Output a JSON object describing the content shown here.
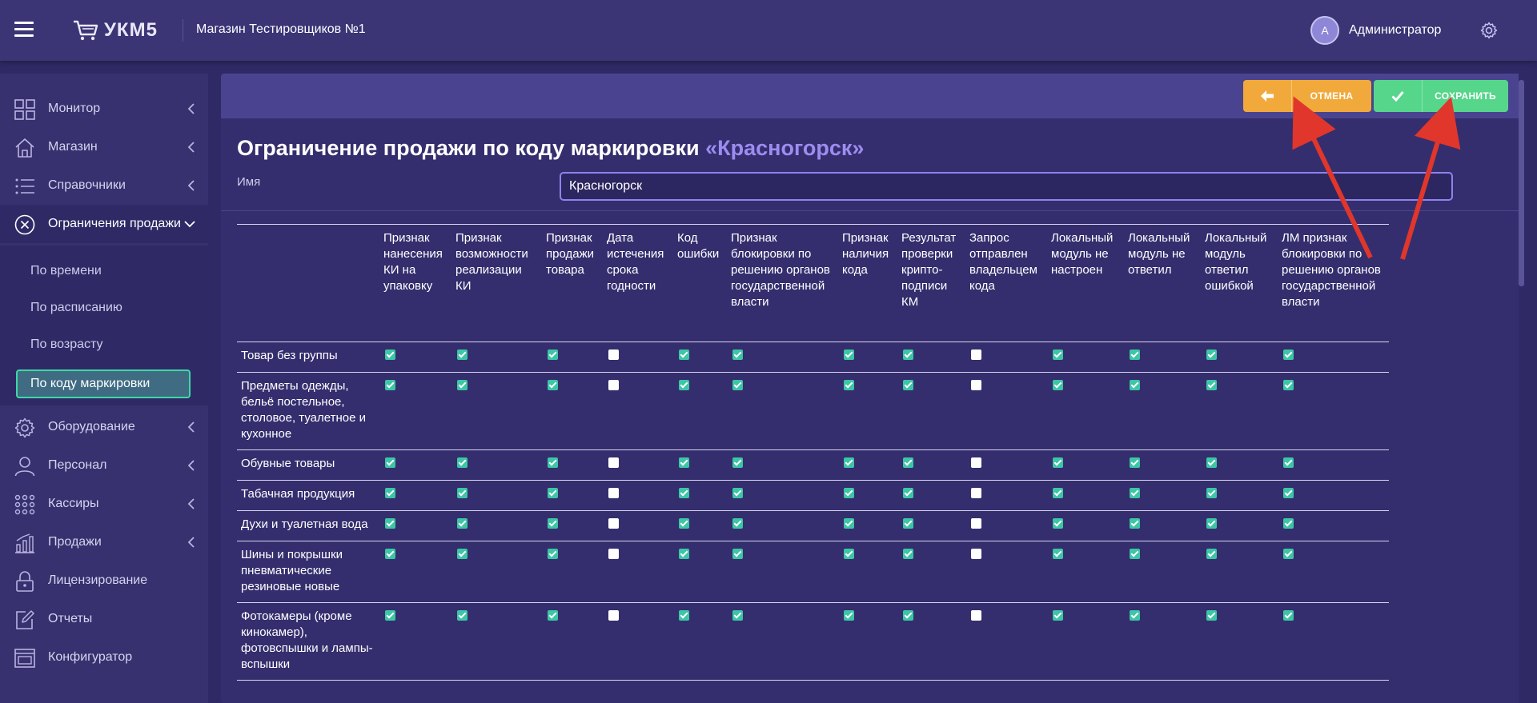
{
  "header": {
    "logo_text": "УКМ5",
    "store_name": "Магазин Тестировщиков №1",
    "user_initial": "А",
    "user_name": "Администратор"
  },
  "sidebar": {
    "items": [
      {
        "label": "Монитор",
        "icon": "grid-icon"
      },
      {
        "label": "Магазин",
        "icon": "house-icon"
      },
      {
        "label": "Справочники",
        "icon": "list-icon"
      },
      {
        "label": "Ограничения продажи",
        "icon": "circle-x-icon"
      },
      {
        "label": "Оборудование",
        "icon": "gear-icon"
      },
      {
        "label": "Персонал",
        "icon": "person-icon"
      },
      {
        "label": "Кассиры",
        "icon": "dots-grid-icon"
      },
      {
        "label": "Продажи",
        "icon": "bar-chart-icon"
      },
      {
        "label": "Лицензирование",
        "icon": "lock-icon"
      },
      {
        "label": "Отчеты",
        "icon": "edit-icon"
      },
      {
        "label": "Конфигуратор",
        "icon": "window-icon"
      }
    ],
    "subitems": [
      "По времени",
      "По расписанию",
      "По возрасту",
      "По коду маркировки"
    ]
  },
  "toolbar": {
    "cancel_label": "ОТМЕНА",
    "save_label": "СОХРАНИТЬ"
  },
  "main": {
    "title_prefix": "Ограничение продажи по коду маркировки",
    "title_accent": "«Красногорск»",
    "name_label": "Имя",
    "name_value": "Красногорск"
  },
  "table": {
    "columns": [
      "Признак нанесения КИ на упаковку",
      "Признак возможности реализации КИ",
      "Признак продажи товара",
      "Дата истечения срока годности",
      "Код ошибки",
      "Признак блокировки по решению органов государственной власти",
      "Признак наличия кода",
      "Результат проверки крипто-подписи КМ",
      "Запрос отправлен владельцем кода",
      "Локальный модуль не настроен",
      "Локальный модуль не ответил",
      "Локальный модуль ответил ошибкой",
      "ЛМ признак блокировки по решению органов государственной власти"
    ],
    "rows": [
      {
        "name": "Товар без группы",
        "checks": [
          true,
          true,
          true,
          false,
          true,
          true,
          true,
          true,
          false,
          true,
          true,
          true,
          true
        ]
      },
      {
        "name": "Предметы одежды, бельё постельное, столовое, туалетное и кухонное",
        "checks": [
          true,
          true,
          true,
          false,
          true,
          true,
          true,
          true,
          false,
          true,
          true,
          true,
          true
        ]
      },
      {
        "name": "Обувные товары",
        "checks": [
          true,
          true,
          true,
          false,
          true,
          true,
          true,
          true,
          false,
          true,
          true,
          true,
          true
        ]
      },
      {
        "name": "Табачная продукция",
        "checks": [
          true,
          true,
          true,
          false,
          true,
          true,
          true,
          true,
          false,
          true,
          true,
          true,
          true
        ]
      },
      {
        "name": "Духи и туалетная вода",
        "checks": [
          true,
          true,
          true,
          false,
          true,
          true,
          true,
          true,
          false,
          true,
          true,
          true,
          true
        ]
      },
      {
        "name": "Шины и покрышки пневматические резиновые новые",
        "checks": [
          true,
          true,
          true,
          false,
          true,
          true,
          true,
          true,
          false,
          true,
          true,
          true,
          true
        ]
      },
      {
        "name": "Фотокамеры (кроме кинокамер), фотовспышки и лампы-вспышки",
        "checks": [
          true,
          true,
          true,
          false,
          true,
          true,
          true,
          true,
          false,
          true,
          true,
          true,
          true
        ]
      }
    ]
  },
  "colors": {
    "background": "#2f2a66",
    "cancel": "#f2a93b",
    "save": "#55d68a",
    "accent": "#9b8df0",
    "checkbox_on": "#3cc6a6",
    "annotation_arrow": "#e0362c"
  }
}
